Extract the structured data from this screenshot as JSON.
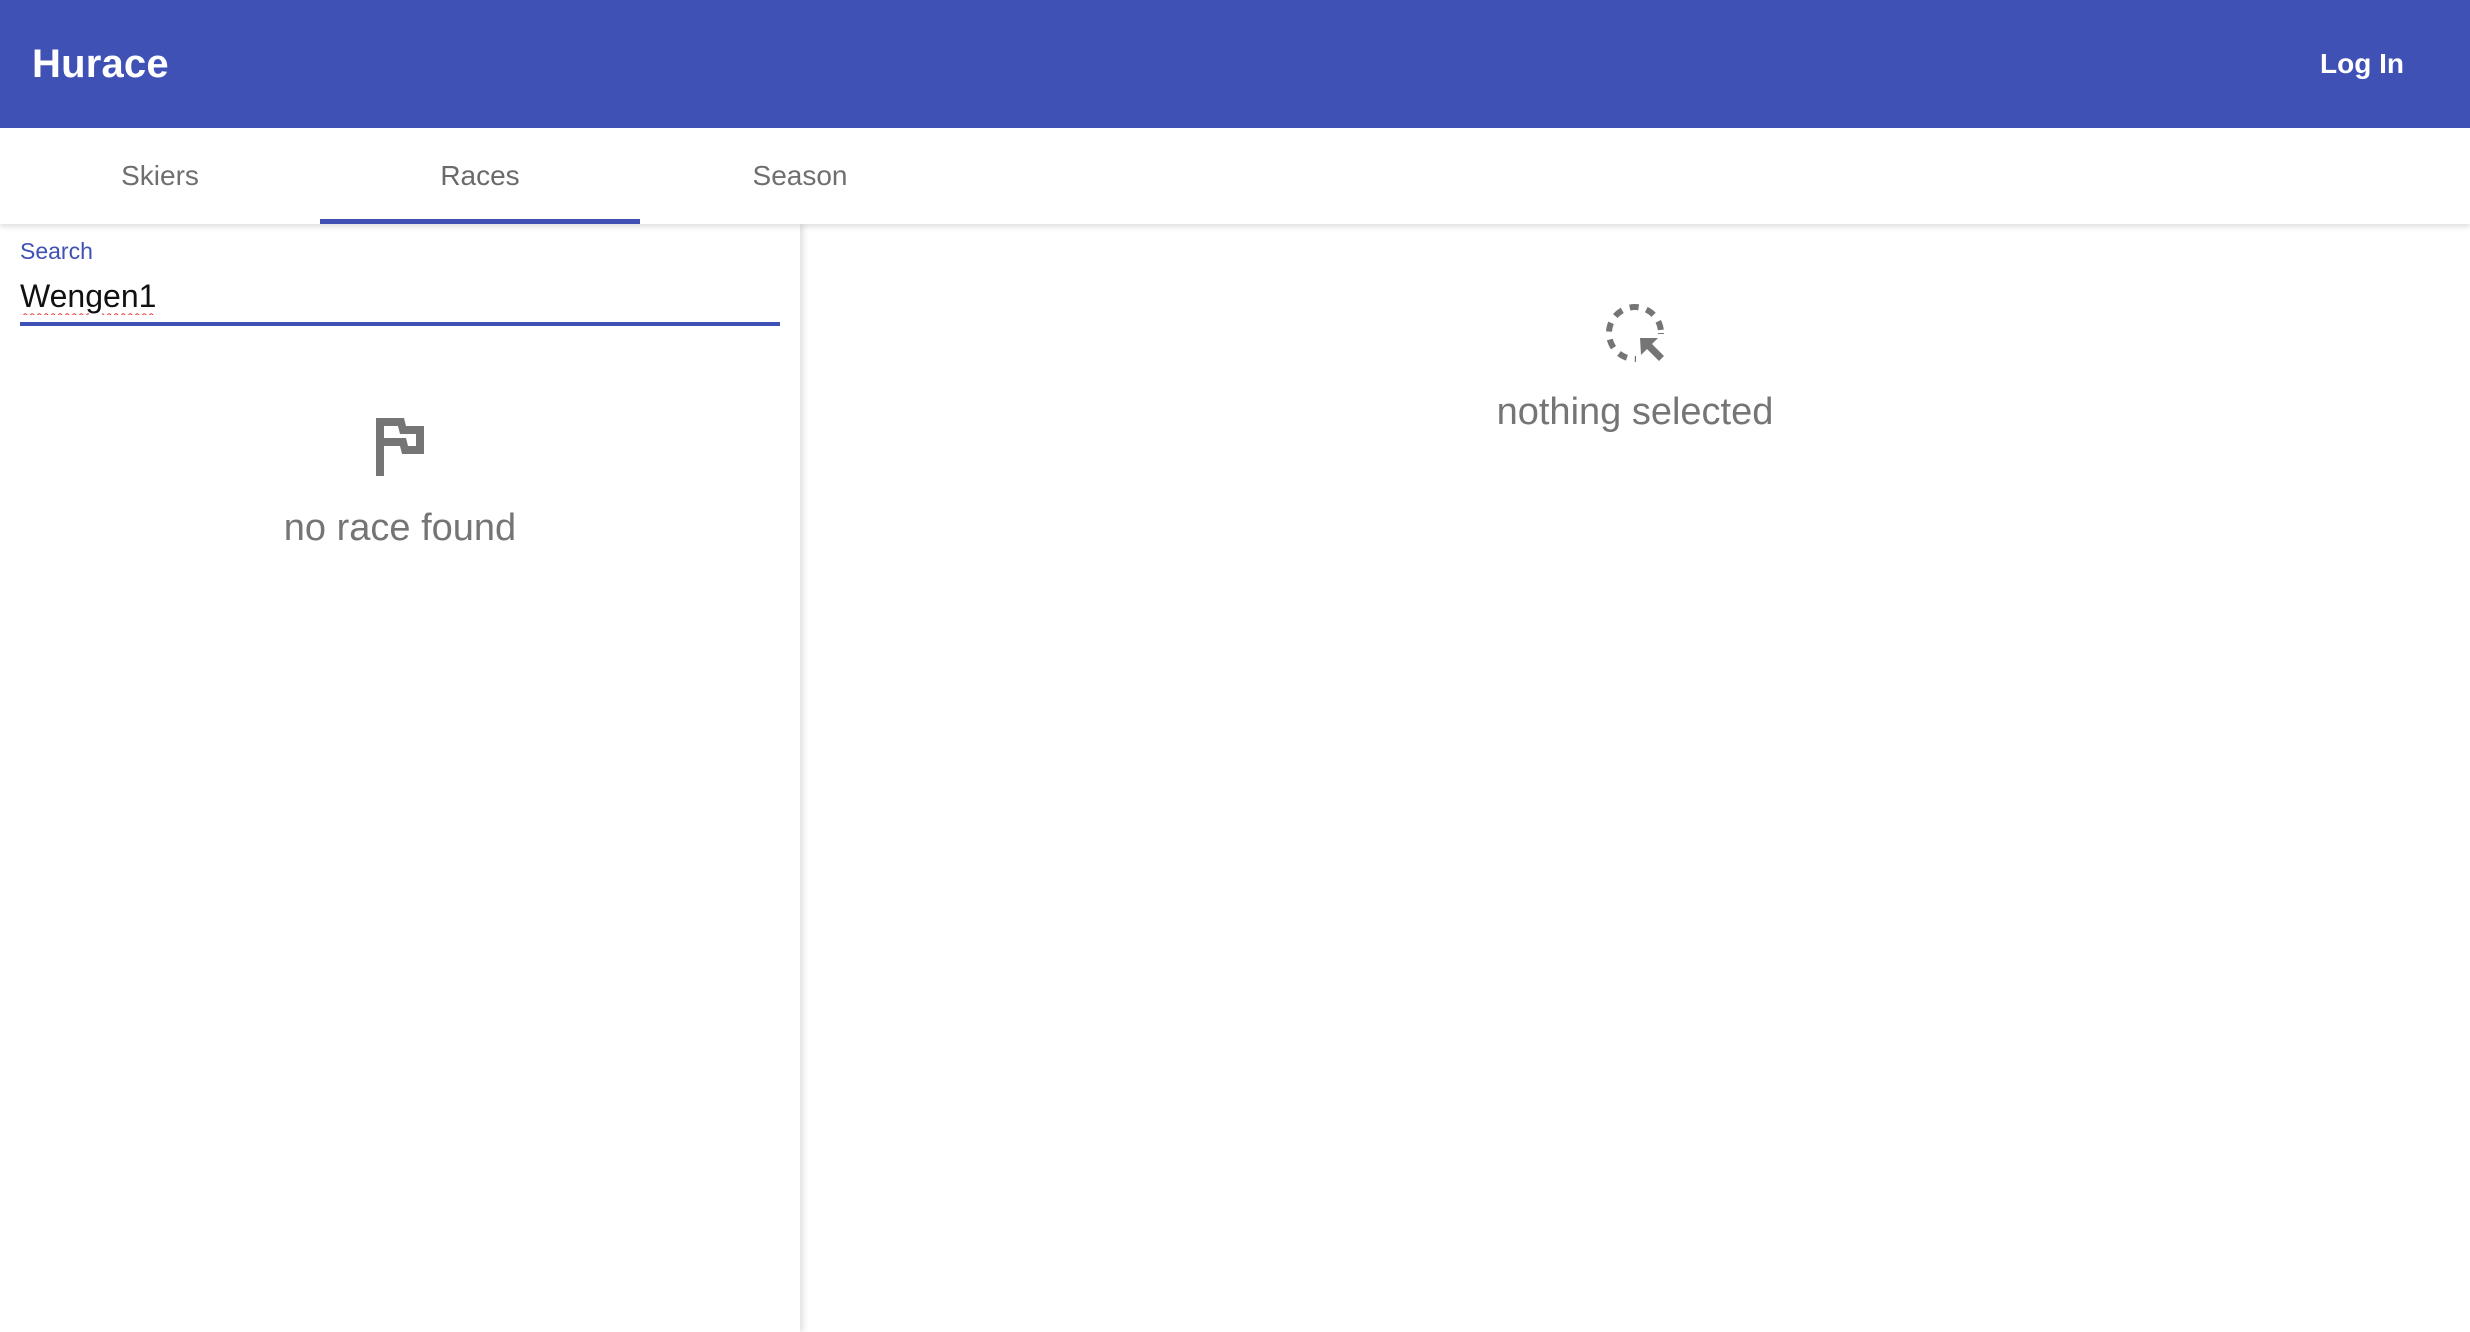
{
  "app_bar": {
    "title": "Hurace",
    "login_label": "Log In",
    "color": "#3f51b5"
  },
  "tabs": [
    {
      "label": "Skiers",
      "active": false
    },
    {
      "label": "Races",
      "active": true
    },
    {
      "label": "Season",
      "active": false
    }
  ],
  "search": {
    "label": "Search",
    "value": "Wengen1"
  },
  "race_list": {
    "empty_icon": "flag-icon",
    "empty_text": "no race found"
  },
  "detail": {
    "empty_icon": "select-cursor-icon",
    "empty_text": "nothing selected"
  }
}
